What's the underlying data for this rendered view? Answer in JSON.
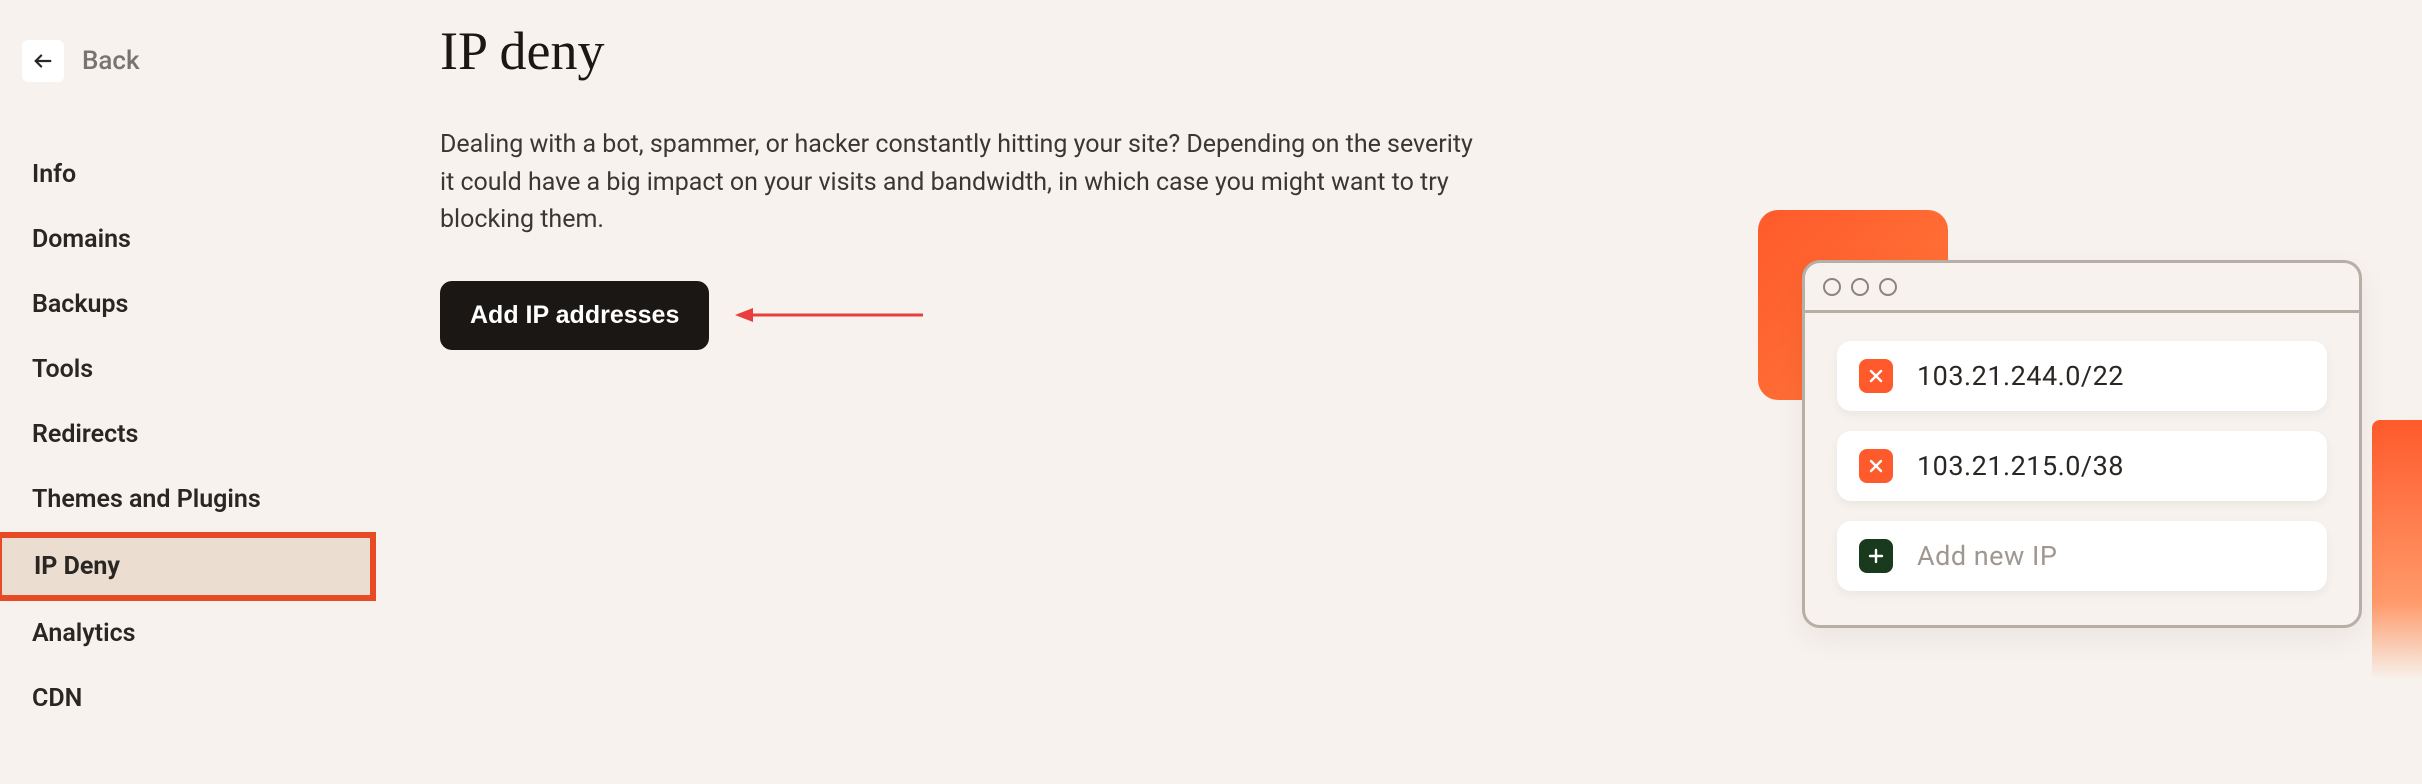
{
  "back_label": "Back",
  "nav": [
    {
      "label": "Info"
    },
    {
      "label": "Domains"
    },
    {
      "label": "Backups"
    },
    {
      "label": "Tools"
    },
    {
      "label": "Redirects"
    },
    {
      "label": "Themes and Plugins"
    },
    {
      "label": "IP Deny",
      "active": true
    },
    {
      "label": "Analytics"
    },
    {
      "label": "CDN"
    }
  ],
  "page_title": "IP deny",
  "description": "Dealing with a bot, spammer, or hacker constantly hitting your site? Depending on the severity it could have a big impact on your visits and bandwidth, in which case you might want to try blocking them.",
  "add_button_label": "Add IP addresses",
  "illustration": {
    "entries": [
      {
        "ip": "103.21.244.0/22",
        "action": "remove"
      },
      {
        "ip": "103.21.215.0/38",
        "action": "remove"
      }
    ],
    "add_new_label": "Add new IP"
  }
}
